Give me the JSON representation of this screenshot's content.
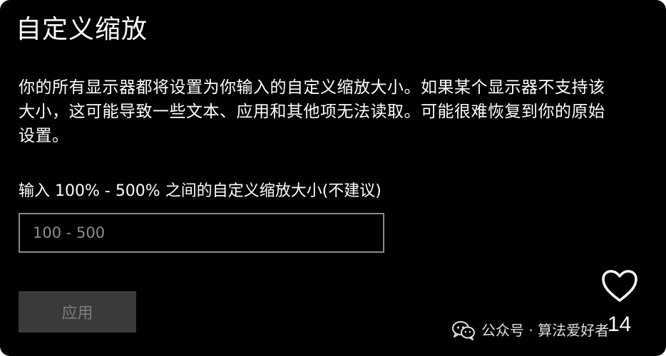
{
  "dialog": {
    "title": "自定义缩放",
    "description": "你的所有显示器都将设置为你输入的自定义缩放大小。如果某个显示器不支持该大小，这可能导致一些文本、应用和其他项无法读取。可能很难恢复到你的原始设置。",
    "input_label": "输入 100% - 500% 之间的自定义缩放大小(不建议)",
    "input_placeholder": "100 - 500",
    "input_value": "",
    "apply_label": "应用"
  },
  "overlay": {
    "like_icon": "heart-outline-icon",
    "like_count": "14",
    "watermark_icon": "wechat-icon",
    "watermark_text": "公众号 · 算法爱好者"
  }
}
